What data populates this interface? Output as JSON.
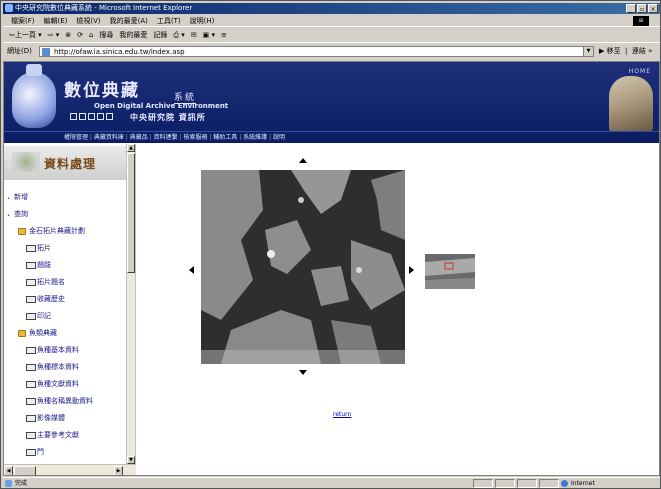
{
  "window": {
    "title": "中央研究院數位典藏系統 - Microsoft Internet Explorer",
    "minimize": "_",
    "maximize": "▫",
    "close": "×"
  },
  "menubar": {
    "items": [
      "檔案(F)",
      "編輯(E)",
      "檢視(V)",
      "我的最愛(A)",
      "工具(T)",
      "說明(H)"
    ]
  },
  "toolbar": {
    "items": [
      "⇦上一頁 ▾",
      "⇨ ▾",
      "⊗",
      "⟳",
      "⌂",
      "搜尋",
      "我的最愛",
      "記錄",
      "⎙ ▾",
      "✉",
      "▣ ▾",
      "≡"
    ]
  },
  "address": {
    "label": "網址(D)",
    "url": "http://ofaw.ia.sinica.edu.tw/index.asp",
    "go_label": "移至",
    "links_label": "連結 »"
  },
  "banner": {
    "logo": "數位典藏",
    "system": "系統",
    "english": "Open Digital Archive Environment",
    "org": "中央研究院 資訊所",
    "home": "HOME"
  },
  "navbar": {
    "items": [
      "權限管理",
      "典藏資料庫",
      "典藏品",
      "資料連繫",
      "檢索服務",
      "輔助工具",
      "系統維護",
      "說明"
    ]
  },
  "sidebar": {
    "heading": "資料處理",
    "tree": [
      {
        "type": "bullet",
        "label": "新增",
        "level": 0
      },
      {
        "type": "bullet",
        "label": "查詢",
        "level": 0
      },
      {
        "type": "folder",
        "label": "金石拓片典藏計劃",
        "level": 1
      },
      {
        "type": "doc",
        "label": "拓片",
        "level": 2
      },
      {
        "type": "doc",
        "label": "題跋",
        "level": 2
      },
      {
        "type": "doc",
        "label": "拓片題名",
        "level": 2
      },
      {
        "type": "doc",
        "label": "收藏歷史",
        "level": 2
      },
      {
        "type": "doc",
        "label": "印記",
        "level": 2
      },
      {
        "type": "folder",
        "label": "魚類典藏",
        "level": 1
      },
      {
        "type": "doc",
        "label": "魚種基本資料",
        "level": 2
      },
      {
        "type": "doc",
        "label": "魚種標本資料",
        "level": 2
      },
      {
        "type": "doc",
        "label": "魚種文獻資料",
        "level": 2
      },
      {
        "type": "doc",
        "label": "魚種名稱異動資料",
        "level": 2
      },
      {
        "type": "doc",
        "label": "影像媒體",
        "level": 2
      },
      {
        "type": "doc",
        "label": "主要參考文獻",
        "level": 2
      },
      {
        "type": "doc",
        "label": "門",
        "level": 2
      }
    ]
  },
  "main": {
    "return_label": "return"
  },
  "statusbar": {
    "text": "完成",
    "zone": "Internet"
  }
}
